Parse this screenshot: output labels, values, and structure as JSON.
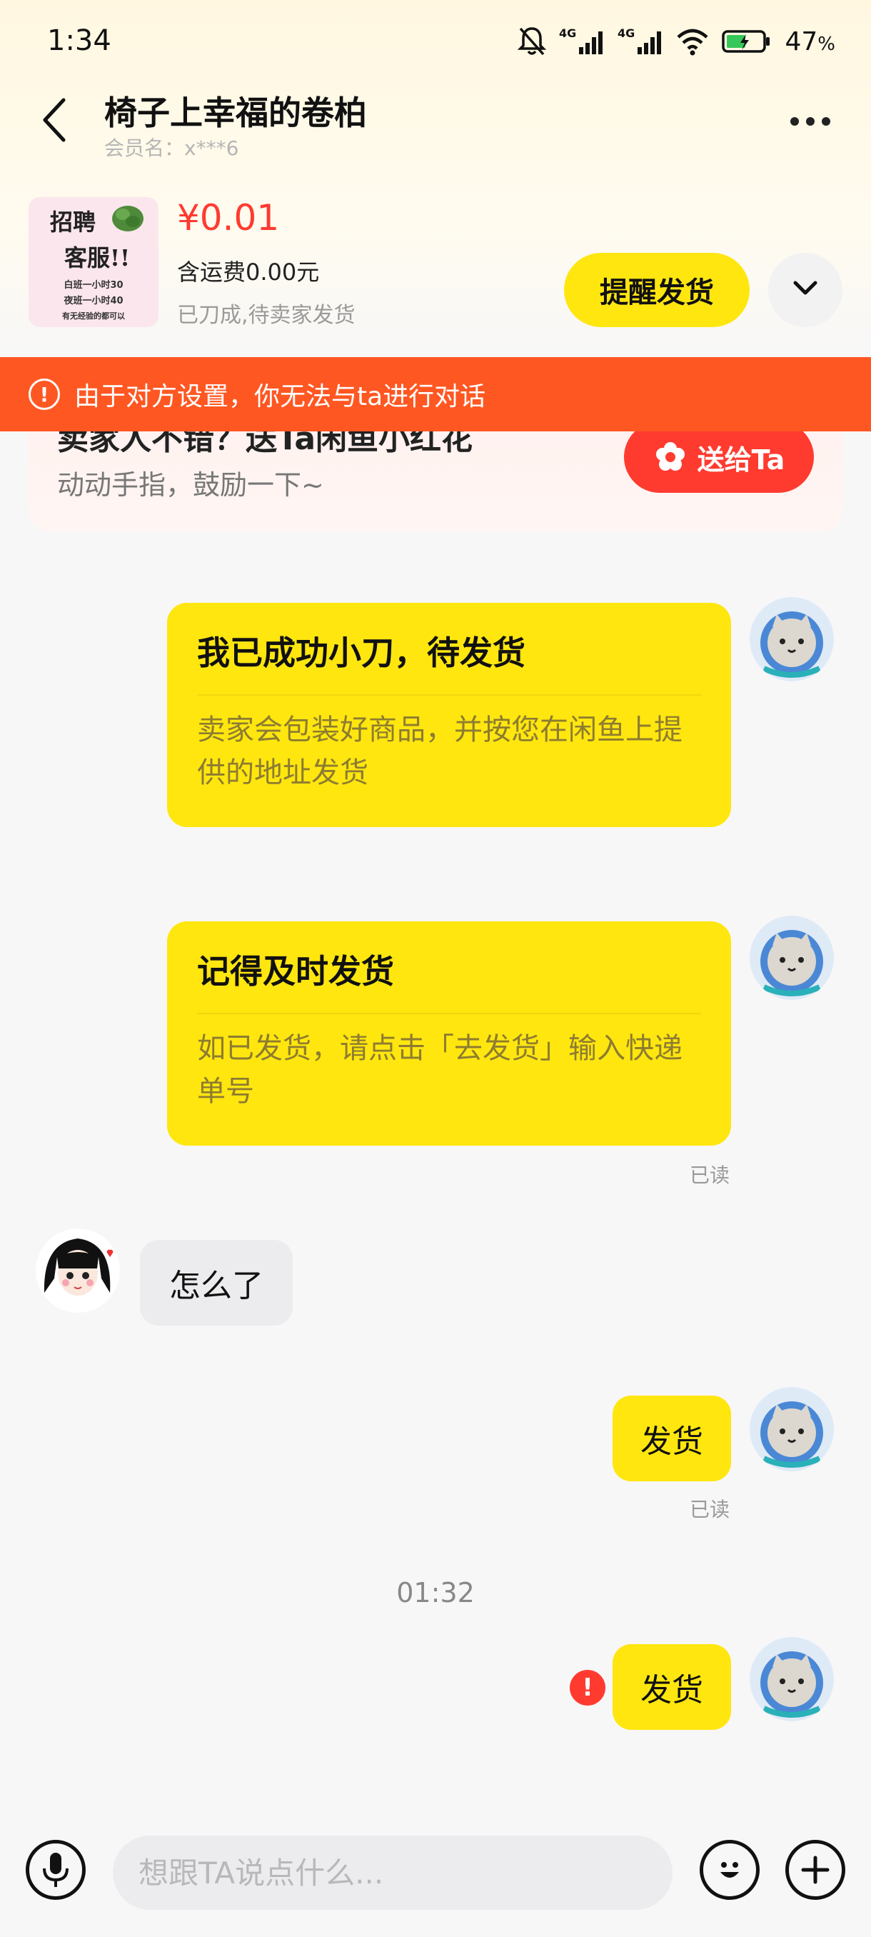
{
  "status_bar": {
    "time": "1:34",
    "battery": "47",
    "battery_unit": "%",
    "network": "4G"
  },
  "header": {
    "title": "椅子上幸福的卷柏",
    "member": "会员名：x***6"
  },
  "product": {
    "image_text": [
      "招聘",
      "客服!!",
      "白班一小时30",
      "夜班一小时40",
      "有无经验的都可以"
    ],
    "price": "¥0.01",
    "shipping": "含运费0.00元",
    "status": "已刀成,待卖家发货",
    "remind_label": "提醒发货"
  },
  "flower_card": {
    "title": "卖家人不错？送Ta闲鱼小红花",
    "subtitle": "动动手指，鼓励一下~",
    "send_label": "送给Ta"
  },
  "banner": {
    "text": "由于对方设置，你无法与ta进行对话"
  },
  "messages": {
    "card1": {
      "title": "我已成功小刀，待发货",
      "body": "卖家会包装好商品，并按您在闲鱼上提供的地址发货"
    },
    "card2": {
      "title": "记得及时发货",
      "body": "如已发货，请点击「去发货」输入快递单号",
      "read": "已读"
    },
    "seller_msg": "怎么了",
    "msg3": {
      "text": "发货",
      "read": "已读"
    },
    "timestamp": "01:32",
    "msg4": {
      "text": "发货"
    }
  },
  "input": {
    "placeholder": "想跟TA说点什么..."
  },
  "colors": {
    "accent_yellow": "#ffe60f",
    "banner_orange": "#ff5722",
    "price_red": "#ff3b30"
  },
  "icons": [
    "back-arrow-icon",
    "more-icon",
    "chevron-down-icon",
    "flower-icon",
    "warning-icon",
    "mic-icon",
    "emoji-icon",
    "plus-icon",
    "error-icon"
  ]
}
